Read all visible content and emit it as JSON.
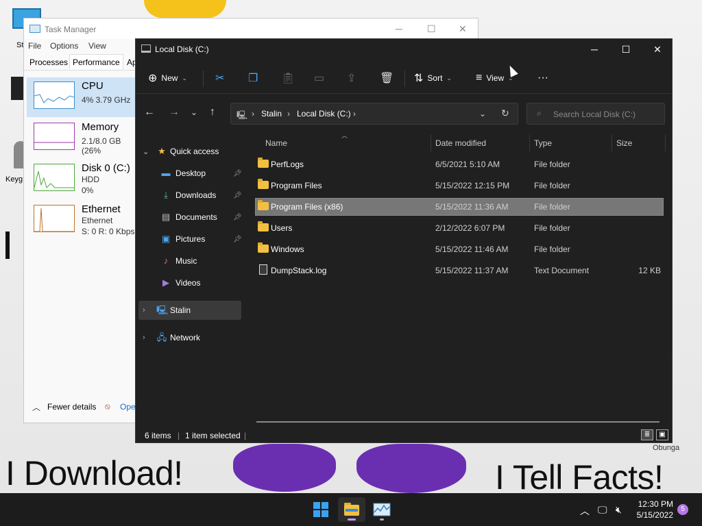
{
  "desktop": {
    "meme_left": "I Download!",
    "meme_right": "I Tell Facts!",
    "icon_labels": [
      "St",
      "Keyg",
      "Obunga"
    ]
  },
  "task_manager": {
    "title": "Task Manager",
    "menu": [
      "File",
      "Options",
      "View"
    ],
    "tabs": [
      "Processes",
      "Performance",
      "Ap"
    ],
    "items": [
      {
        "name": "CPU",
        "line1": "4% 3.79 GHz",
        "line2": ""
      },
      {
        "name": "Memory",
        "line1": "2.1/8.0 GB (26%",
        "line2": ""
      },
      {
        "name": "Disk 0 (C:)",
        "line1": "HDD",
        "line2": "0%"
      },
      {
        "name": "Ethernet",
        "line1": "Ethernet",
        "line2": "S: 0 R: 0 Kbps"
      }
    ],
    "fewer_details": "Fewer details",
    "open_link": "Ope"
  },
  "explorer": {
    "title": "Local Disk (C:)",
    "toolbar": {
      "new": "New",
      "sort": "Sort",
      "view": "View"
    },
    "breadcrumb": [
      "Stalin",
      "Local Disk (C:)"
    ],
    "search_placeholder": "Search Local Disk (C:)",
    "sidebar": [
      {
        "label": "Quick access",
        "icon": "star-icon"
      },
      {
        "label": "Desktop",
        "icon": "desktop-icon"
      },
      {
        "label": "Downloads",
        "icon": "download-icon"
      },
      {
        "label": "Documents",
        "icon": "document-icon"
      },
      {
        "label": "Pictures",
        "icon": "picture-icon"
      },
      {
        "label": "Music",
        "icon": "music-icon"
      },
      {
        "label": "Videos",
        "icon": "video-icon"
      },
      {
        "label": "Stalin",
        "icon": "computer-icon"
      },
      {
        "label": "Network",
        "icon": "network-icon"
      }
    ],
    "columns": {
      "name": "Name",
      "date": "Date modified",
      "type": "Type",
      "size": "Size"
    },
    "files": [
      {
        "name": "PerfLogs",
        "date": "6/5/2021 5:10 AM",
        "type": "File folder",
        "size": ""
      },
      {
        "name": "Program Files",
        "date": "5/15/2022 12:15 PM",
        "type": "File folder",
        "size": ""
      },
      {
        "name": "Program Files (x86)",
        "date": "5/15/2022 11:36 AM",
        "type": "File folder",
        "size": ""
      },
      {
        "name": "Users",
        "date": "2/12/2022 6:07 PM",
        "type": "File folder",
        "size": ""
      },
      {
        "name": "Windows",
        "date": "5/15/2022 11:46 AM",
        "type": "File folder",
        "size": ""
      },
      {
        "name": "DumpStack.log",
        "date": "5/15/2022 11:37 AM",
        "type": "Text Document",
        "size": "12 KB"
      }
    ],
    "status": {
      "items": "6 items",
      "selected": "1 item selected"
    }
  },
  "taskbar": {
    "time": "12:30 PM",
    "date": "5/15/2022",
    "notifications": "5"
  }
}
